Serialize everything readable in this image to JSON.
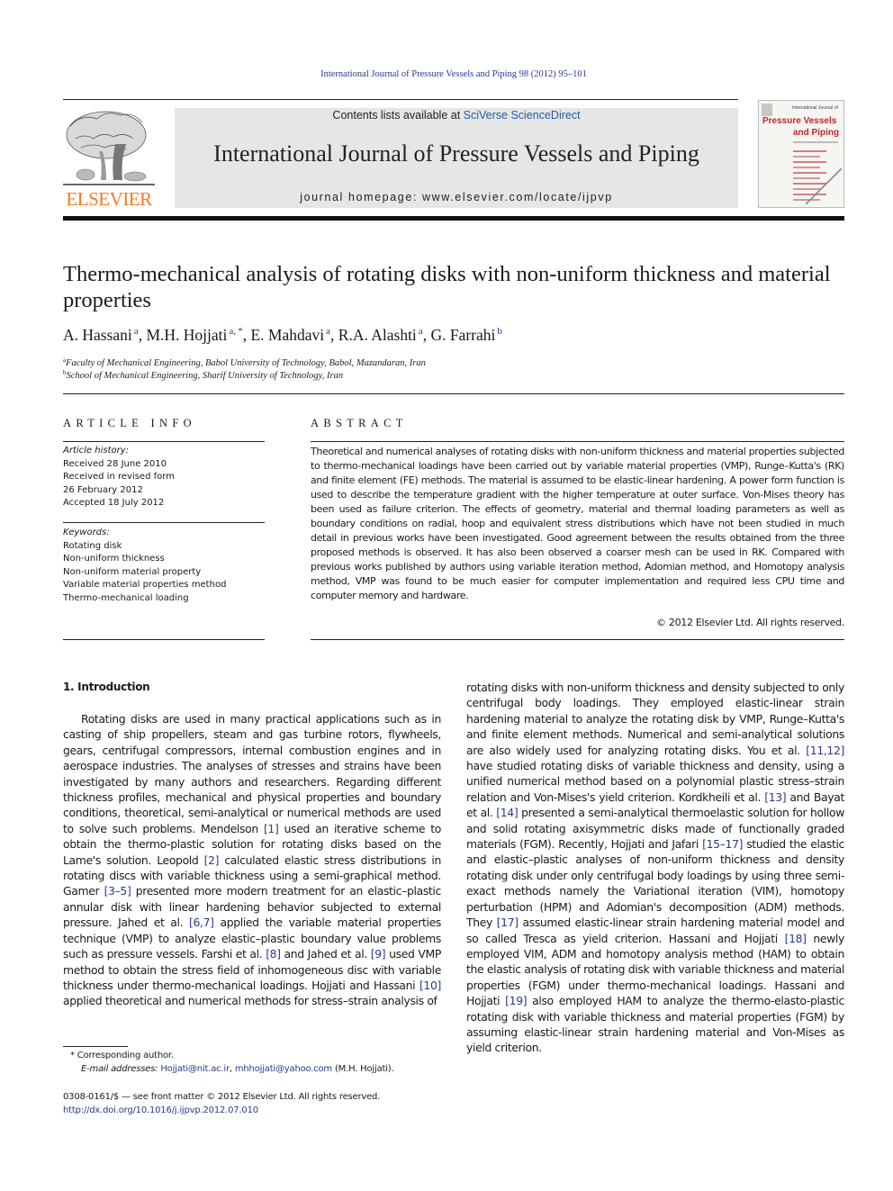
{
  "running_head": "International Journal of Pressure Vessels and Piping 98 (2012) 95–101",
  "masthead": {
    "publisher_logo_text": "ELSEVIER",
    "contents_prefix": "Contents lists available at ",
    "contents_link": "SciVerse ScienceDirect",
    "journal_name": "International Journal of Pressure Vessels and Piping",
    "homepage_label": "journal homepage: www.elsevier.com/locate/ijpvp",
    "cover": {
      "small_title": "International Journal of",
      "title_line1": "Pressure Vessels",
      "title_line2": "and Piping"
    }
  },
  "article": {
    "title": "Thermo-mechanical analysis of rotating disks with non-uniform thickness and material properties",
    "authors": [
      {
        "name": "A. Hassani",
        "sup": "a"
      },
      {
        "name": "M.H. Hojjati",
        "sup": "a, *"
      },
      {
        "name": "E. Mahdavi",
        "sup": "a"
      },
      {
        "name": "R.A. Alashti",
        "sup": "a"
      },
      {
        "name": "G. Farrahi",
        "sup": "b"
      }
    ],
    "affiliations": [
      {
        "sup": "a",
        "text": "Faculty of Mechanical Engineering, Babol University of Technology, Babol, Mazandaran, Iran"
      },
      {
        "sup": "b",
        "text": "School of Mechanical Engineering, Sharif University of Technology, Iran"
      }
    ]
  },
  "article_info": {
    "heading": "ARTICLE INFO",
    "history_label": "Article history:",
    "history": [
      "Received 28 June 2010",
      "Received in revised form",
      "26 February 2012",
      "Accepted 18 July 2012"
    ],
    "keywords_label": "Keywords:",
    "keywords": [
      "Rotating disk",
      "Non-uniform thickness",
      "Non-uniform material property",
      "Variable material properties method",
      "Thermo-mechanical loading"
    ]
  },
  "abstract": {
    "heading": "ABSTRACT",
    "text": "Theoretical and numerical analyses of rotating disks with non-uniform thickness and material properties subjected to thermo-mechanical loadings have been carried out by variable material properties (VMP), Runge–Kutta's (RK) and finite element (FE) methods. The material is assumed to be elastic-linear hardening. A power form function is used to describe the temperature gradient with the higher temperature at outer surface. Von-Mises theory has been used as failure criterion. The effects of geometry, material and thermal loading parameters as well as boundary conditions on radial, hoop and equivalent stress distributions which have not been studied in much detail in previous works have been investigated. Good agreement between the results obtained from the three proposed methods is observed. It has also been observed a coarser mesh can be used in RK. Compared with previous works published by authors using variable iteration method, Adomian method, and Homotopy analysis method, VMP was found to be much easier for computer implementation and required less CPU time and computer memory and hardware.",
    "copyright": "© 2012 Elsevier Ltd. All rights reserved."
  },
  "introduction": {
    "heading": "1.  Introduction",
    "left_column": [
      {
        "t": "Rotating disks are used in many practical applications such as in casting of ship propellers, steam and gas turbine rotors, flywheels, gears, centrifugal compressors, internal combustion engines and in aerospace industries. The analyses of stresses and strains have been investigated by many authors and researchers. Regarding different thickness profiles, mechanical and physical properties and boundary conditions, theoretical, semi-analytical or numerical methods are used to solve such problems. Mendelson "
      },
      {
        "r": "[1]"
      },
      {
        "t": " used an iterative scheme to obtain the thermo-plastic solution for rotating disks based on the Lame's solution. Leopold "
      },
      {
        "r": "[2]"
      },
      {
        "t": " calculated elastic stress distributions in rotating discs with variable thickness using a semi-graphical method. Gamer "
      },
      {
        "r": "[3–5]"
      },
      {
        "t": " presented more modern treatment for an elastic–plastic annular disk with linear hardening behavior subjected to external pressure. Jahed et al. "
      },
      {
        "r": "[6,7]"
      },
      {
        "t": " applied the variable material properties technique (VMP) to analyze elastic–plastic boundary value problems such as pressure vessels. Farshi et al. "
      },
      {
        "r": "[8]"
      },
      {
        "t": " and Jahed et al. "
      },
      {
        "r": "[9]"
      },
      {
        "t": " used VMP method to obtain the stress field of inhomogeneous disc with variable thickness under thermo-mechanical loadings. Hojjati and Hassani "
      },
      {
        "r": "[10]"
      },
      {
        "t": " applied theoretical and numerical methods for stress–strain analysis of"
      }
    ],
    "right_column": [
      {
        "t": "rotating disks with non-uniform thickness and density subjected to only centrifugal body loadings. They employed elastic-linear strain hardening material to analyze the rotating disk by VMP, Runge–Kutta's and finite element methods. Numerical and semi-analytical solutions are also widely used for analyzing rotating disks. You et al. "
      },
      {
        "r": "[11,12]"
      },
      {
        "t": " have studied rotating disks of variable thickness and density, using a unified numerical method based on a polynomial plastic stress–strain relation and Von-Mises's yield criterion. Kordkheili et al. "
      },
      {
        "r": "[13]"
      },
      {
        "t": " and Bayat et al. "
      },
      {
        "r": "[14]"
      },
      {
        "t": " presented a semi-analytical thermoelastic solution for hollow and solid rotating axisymmetric disks made of functionally graded materials (FGM). Recently, Hojjati and Jafari "
      },
      {
        "r": "[15–17]"
      },
      {
        "t": " studied the elastic and elastic–plastic analyses of non-uniform thickness and density rotating disk under only centrifugal body loadings by using three semi-exact methods namely the Variational iteration (VIM), homotopy perturbation (HPM) and Adomian's decomposition (ADM) methods. They "
      },
      {
        "r": "[17]"
      },
      {
        "t": " assumed elastic-linear strain hardening material model and so called Tresca as yield criterion. Hassani and Hojjati "
      },
      {
        "r": "[18]"
      },
      {
        "t": " newly employed VIM, ADM and homotopy analysis method (HAM) to obtain the elastic analysis of rotating disk with variable thickness and material properties (FGM) under thermo-mechanical loadings. Hassani and Hojjati "
      },
      {
        "r": "[19]"
      },
      {
        "t": " also employed HAM to analyze the thermo-elasto-plastic rotating disk with variable thickness and material properties (FGM) by assuming elastic-linear strain hardening material and Von-Mises as yield criterion."
      }
    ]
  },
  "footnote": {
    "star": "*",
    "corresponding": "Corresponding author.",
    "email_label": "E-mail addresses:",
    "email1": "Hojjati@nit.ac.ir",
    "sep": ", ",
    "email2": "mhhojjati@yahoo.com",
    "email_owner": " (M.H. Hojjati)."
  },
  "front_matter": {
    "issn_line": "0308-0161/$ — see front matter © 2012 Elsevier Ltd. All rights reserved.",
    "doi": "http://dx.doi.org/10.1016/j.ijpvp.2012.07.010"
  },
  "colors": {
    "link": "#2a3a8c",
    "elsevier_orange": "#f47a20",
    "sciencedirect_blue": "#1d5fa8",
    "banner_gray": "#e6e6e6"
  }
}
